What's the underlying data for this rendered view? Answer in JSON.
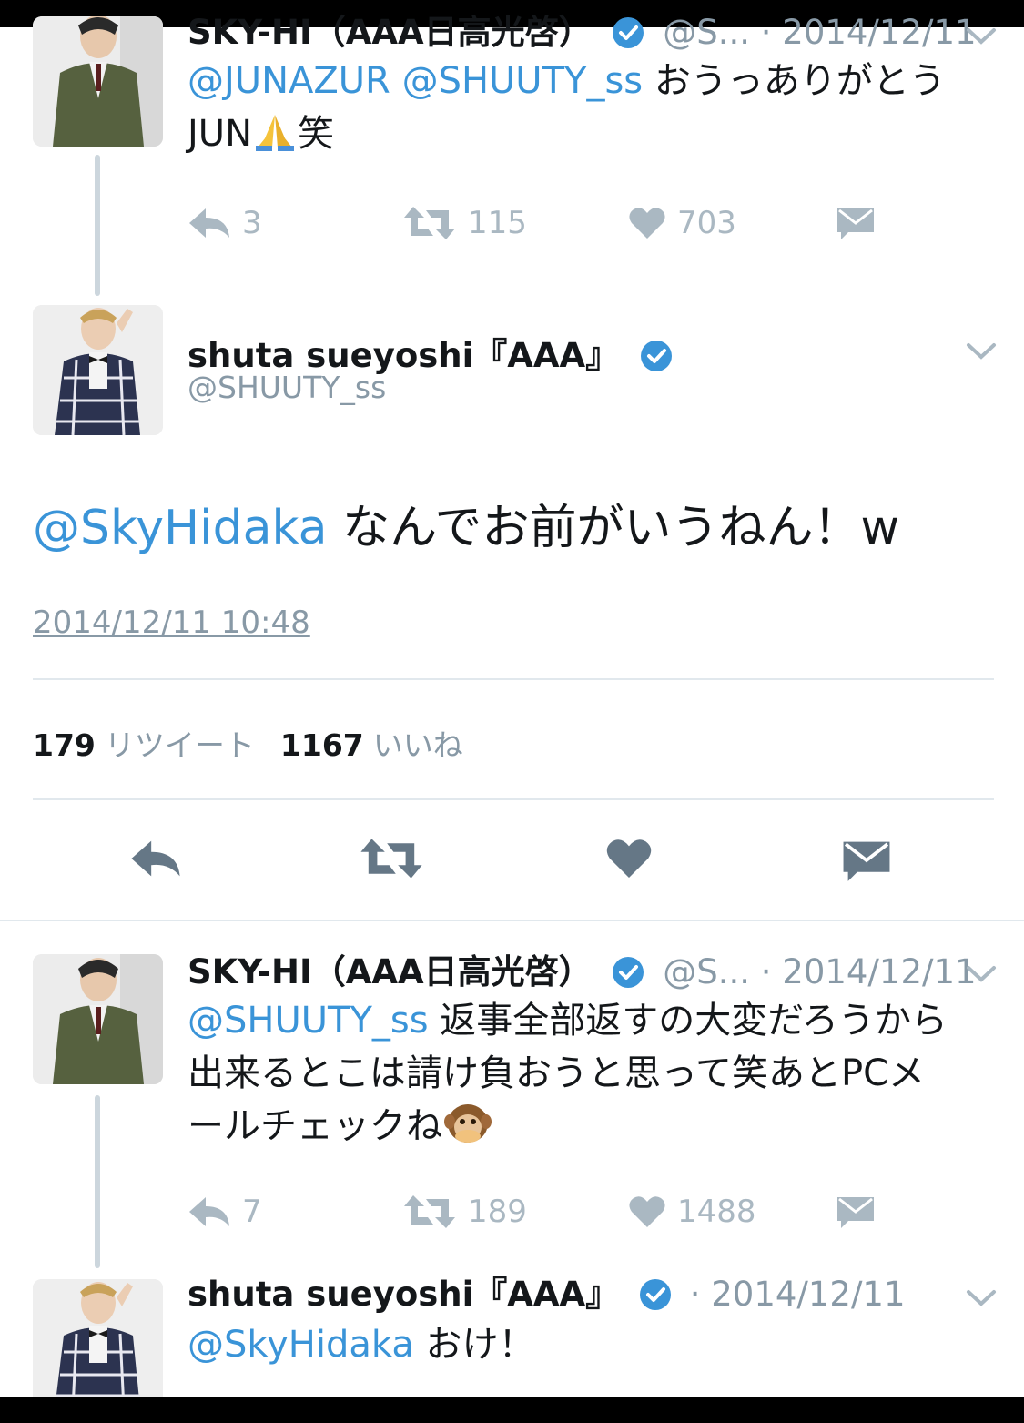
{
  "colors": {
    "accent": "#3a94d8",
    "verified": "#3a94d8",
    "muted": "#8899a6",
    "icon": "#aab8c2",
    "text": "#14171a"
  },
  "tweet1": {
    "name": "SKY-HI（AAA日高光啓）",
    "handle": "@S...",
    "date": "· 2014/12/11",
    "mention1": "@JUNAZUR",
    "mention2": "@SHUUTY_ss",
    "text1": "おうっありがとう",
    "text2": "JUN",
    "emoji": "folded-hands-emoji",
    "text3": "笑",
    "replies": "3",
    "retweets": "115",
    "likes": "703"
  },
  "main_tweet": {
    "name": "shuta sueyoshi『AAA』",
    "handle": "@SHUUTY_ss",
    "mention": "@SkyHidaka",
    "text": "なんでお前がいうねん！w",
    "timestamp": "2014/12/11 10:48",
    "retweet_count": "179",
    "retweet_label": "リツイート",
    "like_count": "1167",
    "like_label": "いいね"
  },
  "tweet2": {
    "name": "SKY-HI（AAA日高光啓）",
    "handle": "@S...",
    "date": "· 2014/12/11",
    "mention": "@SHUUTY_ss",
    "line1": "返事全部返すの大変だろうから",
    "line2": "出来るとこは請け負おうと思って笑あとPCメ",
    "line3": "ールチェックね",
    "emoji": "speak-no-evil-monkey-emoji",
    "replies": "7",
    "retweets": "189",
    "likes": "1488"
  },
  "tweet3": {
    "name": "shuta sueyoshi『AAA』",
    "date": "· 2014/12/11",
    "mention": "@SkyHidaka",
    "text": "おけ！"
  }
}
